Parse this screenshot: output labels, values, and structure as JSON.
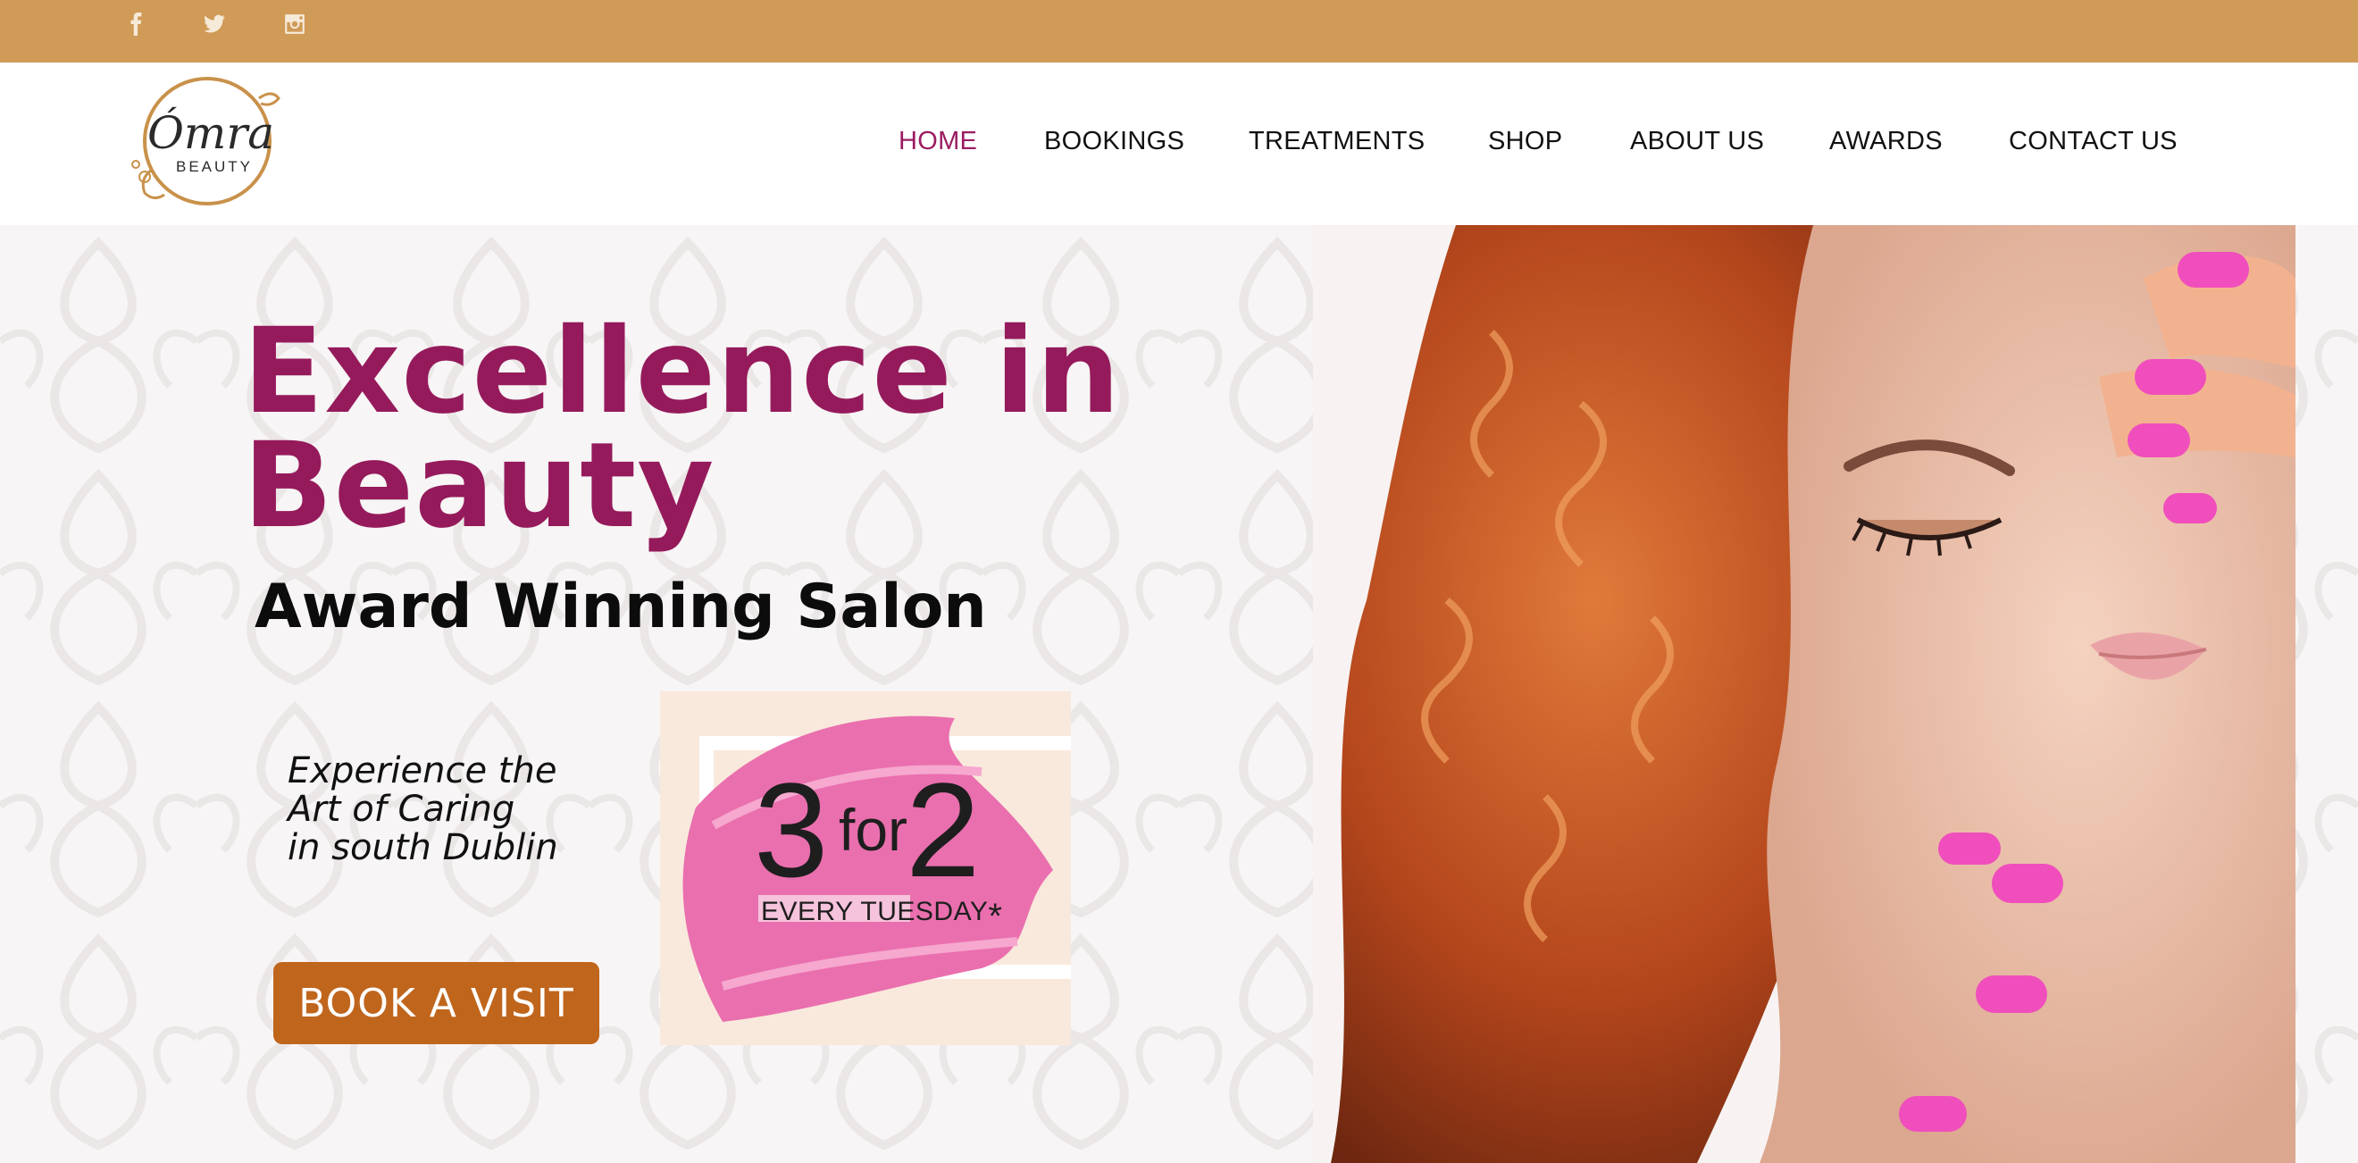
{
  "social": {
    "icons": [
      "facebook-icon",
      "twitter-icon",
      "instagram-icon"
    ],
    "icon_color": "#f6ead9",
    "bar_color": "#d09a57"
  },
  "logo": {
    "name": "Ómra",
    "subtitle": "BEAUTY",
    "ring_color": "#c9914a"
  },
  "nav": {
    "items": [
      {
        "label": "HOME",
        "active": true
      },
      {
        "label": "BOOKINGS"
      },
      {
        "label": "TREATMENTS"
      },
      {
        "label": "SHOP"
      },
      {
        "label": "ABOUT US"
      },
      {
        "label": "AWARDS"
      },
      {
        "label": "CONTACT US"
      }
    ],
    "active_color": "#9b1b62"
  },
  "hero": {
    "headline_line1": "Excellence in",
    "headline_line2": "Beauty",
    "subheadline": "Award Winning Salon",
    "tagline_lines": [
      "Experience the",
      "Art of Caring",
      "in south Dublin"
    ],
    "cta_label": "BOOK A VISIT",
    "headline_color": "#951a5c",
    "cta_color": "#c0651c",
    "promo": {
      "big1": "3",
      "small": "for",
      "big2": "2",
      "caption": "EVERY TUESDAY",
      "asterisk": "*",
      "brush_color": "#ea6fae"
    }
  }
}
